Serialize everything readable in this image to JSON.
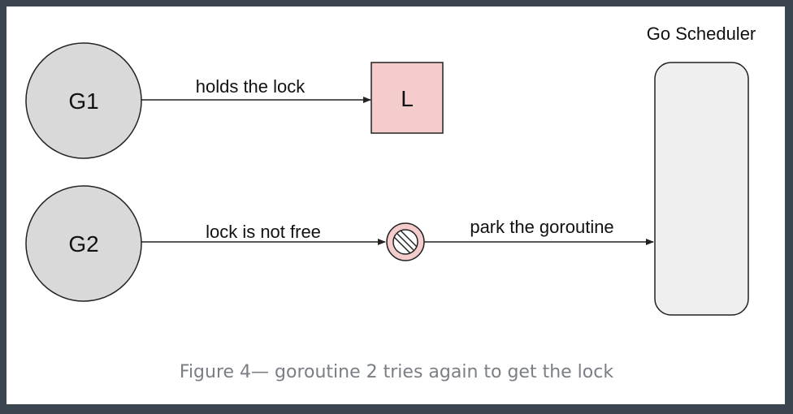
{
  "diagram": {
    "nodes": {
      "g1": {
        "label": "G1"
      },
      "g2": {
        "label": "G2"
      },
      "lock": {
        "label": "L"
      },
      "scheduler": {
        "title": "Go Scheduler"
      }
    },
    "edges": {
      "g1_to_lock": {
        "label": "holds the lock"
      },
      "g2_to_block": {
        "label": "lock is not free"
      },
      "block_to_scheduler": {
        "label": "park the goroutine"
      }
    },
    "colors": {
      "circle_fill": "#d9d9d9",
      "lock_fill": "#f4cccc",
      "block_fill": "#f4cccc",
      "scheduler_fill": "#efefef",
      "stroke": "#222222",
      "frame": "#3a4550",
      "caption": "#7a7f85"
    },
    "icons": {
      "blocked": "no-entry-icon"
    }
  },
  "caption": "Figure 4— goroutine 2 tries again to get the lock"
}
